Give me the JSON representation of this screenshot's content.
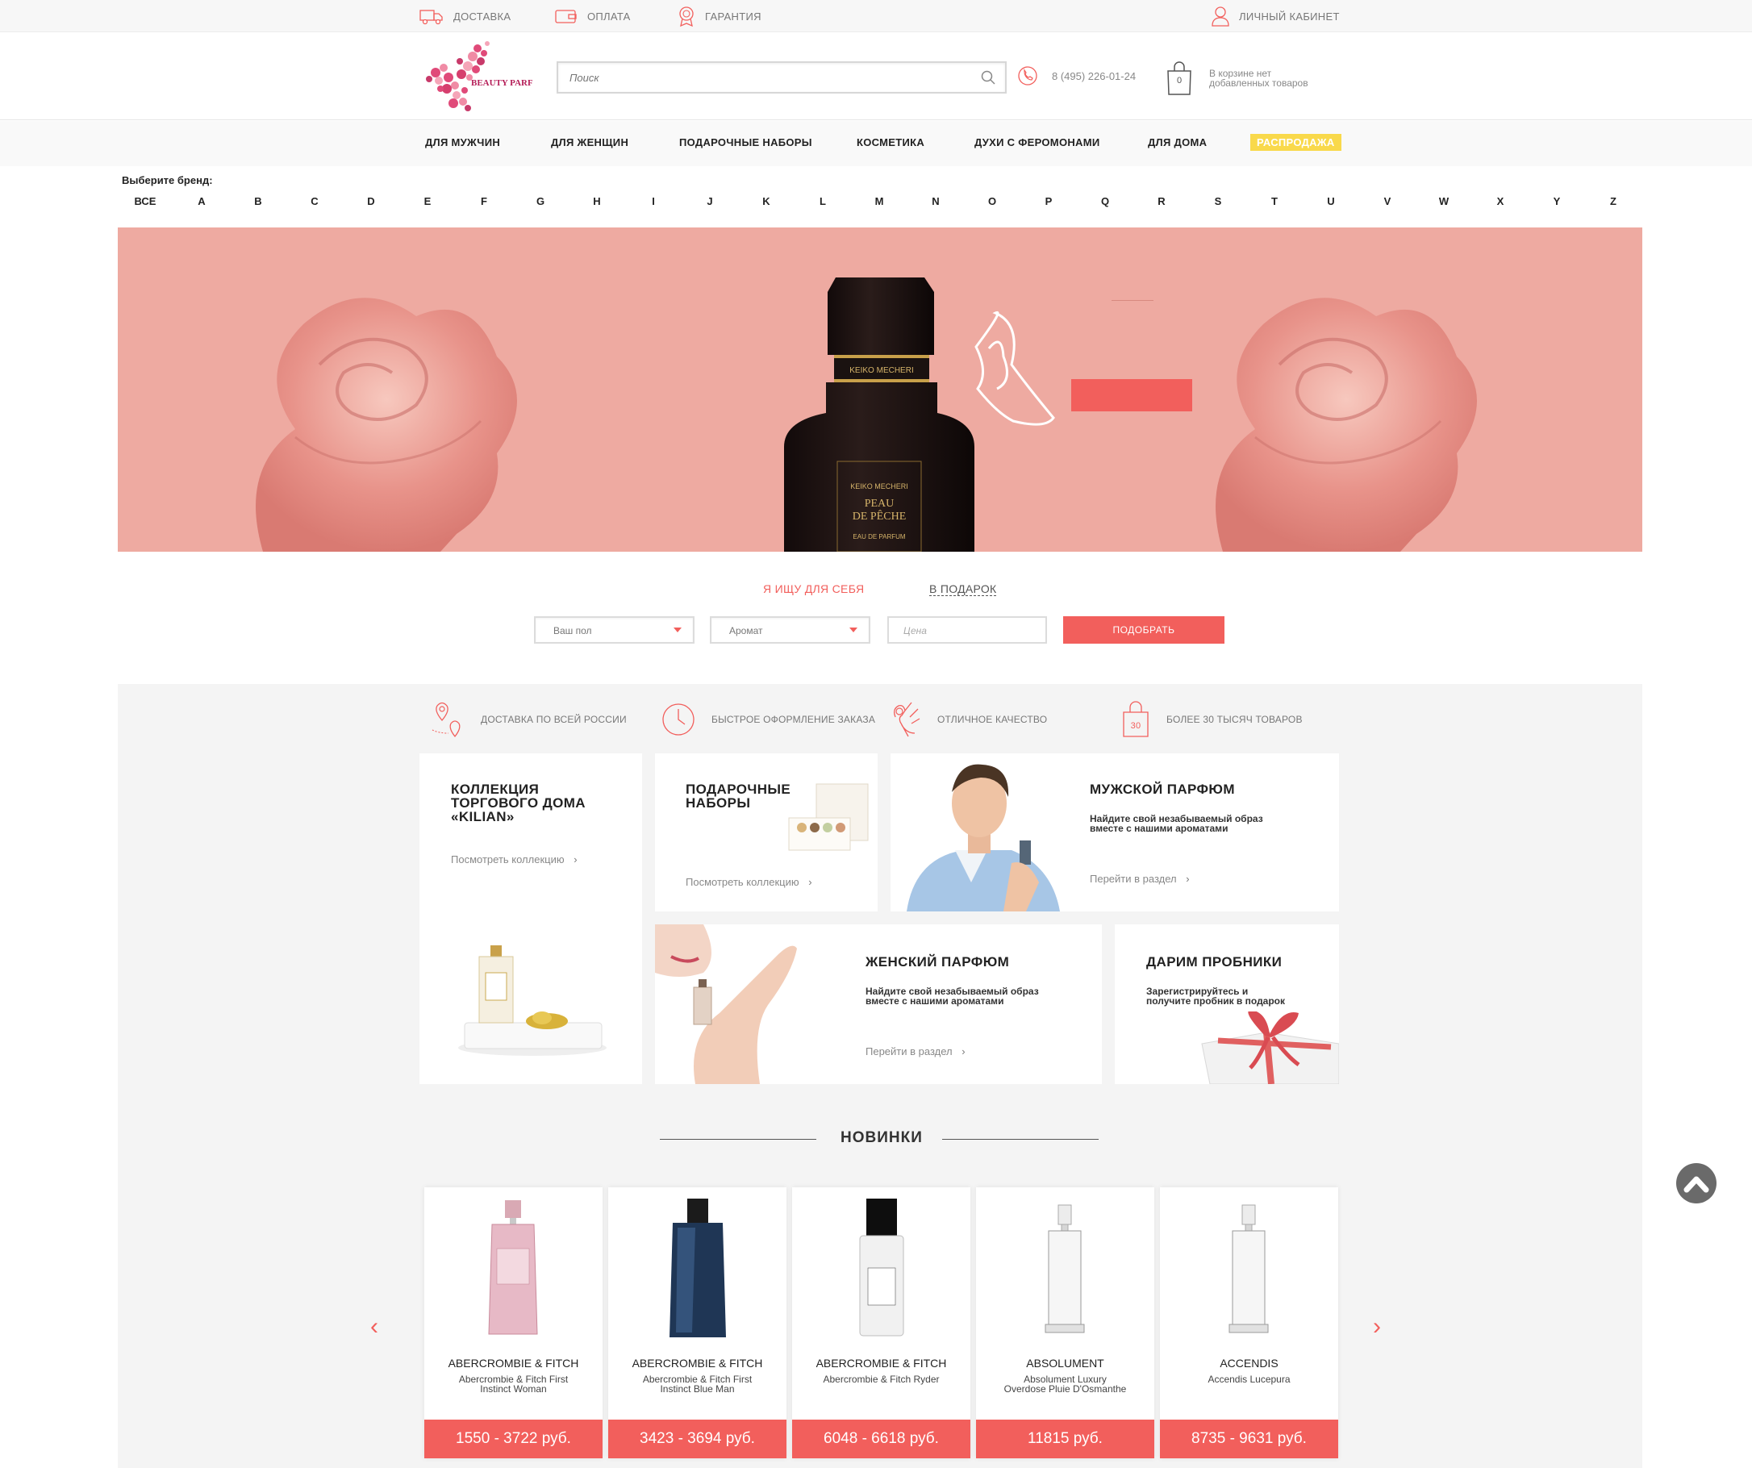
{
  "topbar": {
    "delivery": "ДОСТАВКА",
    "payment": "ОПЛАТА",
    "guarantee": "ГАРАНТИЯ",
    "account": "ЛИЧНЫЙ КАБИНЕТ"
  },
  "header": {
    "logo_text": "BEAUTY PARFUMS",
    "search_placeholder": "Поиск",
    "phone": "8 (495) 226-01-24",
    "cart_count": "0",
    "cart_text_1": "В корзине нет",
    "cart_text_2": "добавленных товаров"
  },
  "nav": {
    "items": [
      "ДЛЯ МУЖЧИН",
      "ДЛЯ ЖЕНЩИН",
      "ПОДАРОЧНЫЕ НАБОРЫ",
      "КОСМЕТИКА",
      "ДУХИ С ФЕРОМОНАМИ",
      "ДЛЯ ДОМА"
    ],
    "sale": "РАСПРОДАЖА"
  },
  "brands": {
    "label": "Выберите бренд:",
    "letters": [
      "ВСЕ",
      "A",
      "B",
      "C",
      "D",
      "E",
      "F",
      "G",
      "H",
      "I",
      "J",
      "K",
      "L",
      "M",
      "N",
      "O",
      "P",
      "Q",
      "R",
      "S",
      "T",
      "U",
      "V",
      "W",
      "X",
      "Y",
      "Z"
    ]
  },
  "banner": {
    "brand_cap": "KEIKO MECHERI",
    "label_brand": "KEIKO MECHERI",
    "label_name_1": "PEAU",
    "label_name_2": "DE PÊCHE",
    "label_type": "EAU DE PARFUM"
  },
  "finder": {
    "tab_self": "Я ИЩУ ДЛЯ СЕБЯ",
    "tab_gift": "В ПОДАРОК",
    "gender": "Ваш пол",
    "aroma": "Аромат",
    "price_placeholder": "Цена",
    "button": "ПОДОБРАТЬ"
  },
  "features": [
    "ДОСТАВКА ПО ВСЕЙ РОССИИ",
    "БЫСТРОЕ ОФОРМЛЕНИЕ ЗАКАЗА",
    "ОТЛИЧНОЕ КАЧЕСТВО",
    "БОЛЕЕ 30 ТЫСЯЧ ТОВАРОВ"
  ],
  "feature_bag_number": "30",
  "cards": {
    "kilian": {
      "l1": "КОЛЛЕКЦИЯ",
      "l2": "ТОРГОВОГО ДОМА",
      "l3": "«KILIAN»",
      "link": "Посмотреть коллекцию"
    },
    "gifts": {
      "l1": "ПОДАРОЧНЫЕ",
      "l2": "НАБОРЫ",
      "link": "Посмотреть коллекцию"
    },
    "men": {
      "title": "МУЖСКОЙ ПАРФЮМ",
      "d1": "Найдите свой незабываемый образ",
      "d2": "вместе с нашими ароматами",
      "link": "Перейти в раздел"
    },
    "women": {
      "title": "ЖЕНСКИЙ ПАРФЮМ",
      "d1": "Найдите свой незабываемый образ",
      "d2": "вместе с нашими ароматами",
      "link": "Перейти в раздел"
    },
    "samples": {
      "title": "ДАРИМ ПРОБНИКИ",
      "d1": "Зарегистрируйтесь и",
      "d2": "получите пробник в подарок"
    }
  },
  "new_title": "НОВИНКИ",
  "products": [
    {
      "brand": "ABERCROMBIE & FITCH",
      "name_1": "Abercrombie & Fitch First",
      "name_2": "Instinct Woman",
      "price": "1550 - 3722 руб."
    },
    {
      "brand": "ABERCROMBIE & FITCH",
      "name_1": "Abercrombie & Fitch First",
      "name_2": "Instinct Blue Man",
      "price": "3423 - 3694 руб."
    },
    {
      "brand": "ABERCROMBIE & FITCH",
      "name_1": "Abercrombie & Fitch Ryder",
      "name_2": "",
      "price": "6048 - 6618 руб."
    },
    {
      "brand": "ABSOLUMENT",
      "name_1": "Absolument Luxury",
      "name_2": "Overdose Pluie D'Osmanthe",
      "price": "11815 руб."
    },
    {
      "brand": "ACCENDIS",
      "name_1": "Accendis Lucepura",
      "name_2": "",
      "price": "8735 - 9631 руб."
    }
  ],
  "colors": {
    "accent": "#f25f5c",
    "sale": "#f9d94b",
    "banner": "#eeaaa1",
    "grey_bg": "#f4f4f4"
  },
  "icons": [
    "truck-icon",
    "wallet-icon",
    "medal-icon",
    "user-icon",
    "search-icon",
    "phone-icon",
    "shopping-bag-icon",
    "map-pin-icon",
    "clock-icon",
    "ok-hand-icon",
    "bag-30-icon",
    "chevron-left-icon",
    "chevron-right-icon",
    "scroll-top-icon"
  ]
}
